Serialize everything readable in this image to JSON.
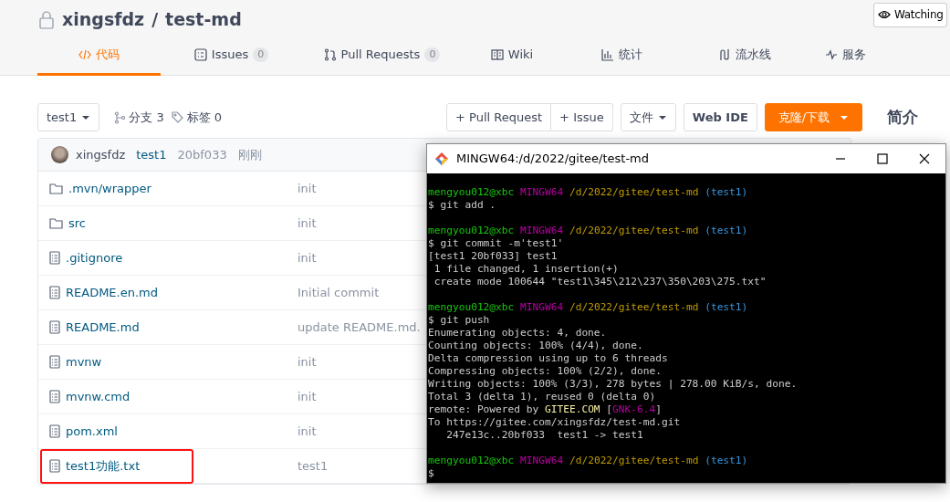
{
  "repo": {
    "owner": "xingsfdz",
    "separator": "/",
    "name": "test-md",
    "watch_label": "Watching"
  },
  "tabs": [
    {
      "kind": "code",
      "label": "代码",
      "selected": true
    },
    {
      "kind": "issues",
      "label": "Issues",
      "count": "0",
      "selected": false
    },
    {
      "kind": "pr",
      "label": "Pull Requests",
      "count": "0",
      "selected": false
    },
    {
      "kind": "wiki",
      "label": "Wiki",
      "selected": false
    },
    {
      "kind": "stats",
      "label": "统计",
      "selected": false
    },
    {
      "kind": "pipeline",
      "label": "流水线",
      "selected": false
    },
    {
      "kind": "service",
      "label": "服务",
      "selected": false
    }
  ],
  "toolbar": {
    "branch": "test1",
    "branches": "分支 3",
    "tags": "标签 0",
    "new_pr": "+ Pull Request",
    "new_issue": "+ Issue",
    "file_menu": "文件",
    "web_ide": "Web IDE",
    "clone": "克隆/下载"
  },
  "sidebar": {
    "title": "简介"
  },
  "commit": {
    "author": "xingsfdz",
    "message": "test1",
    "hash": "20bf033",
    "time": "刚刚"
  },
  "files": [
    {
      "kind": "folder",
      "name": ".mvn/wrapper",
      "message": "init",
      "highlighted": false
    },
    {
      "kind": "folder",
      "name": "src",
      "message": "init",
      "highlighted": false
    },
    {
      "kind": "file",
      "name": ".gitignore",
      "message": "init",
      "highlighted": false
    },
    {
      "kind": "file",
      "name": "README.en.md",
      "message": "Initial commit",
      "highlighted": false
    },
    {
      "kind": "file",
      "name": "README.md",
      "message": "update README.md.",
      "highlighted": false
    },
    {
      "kind": "file",
      "name": "mvnw",
      "message": "init",
      "highlighted": false
    },
    {
      "kind": "file",
      "name": "mvnw.cmd",
      "message": "init",
      "highlighted": false
    },
    {
      "kind": "file",
      "name": "pom.xml",
      "message": "init",
      "highlighted": false
    },
    {
      "kind": "file",
      "name": "test1功能.txt",
      "message": "test1",
      "highlighted": true
    }
  ],
  "terminal": {
    "title": "MINGW64:/d/2022/gitee/test-md",
    "lines": [
      {
        "kind": "text",
        "segments": [
          {
            "kind": "user",
            "text": "mengyou012@xbc"
          },
          {
            "kind": "system",
            "text": "MINGW64"
          },
          {
            "kind": "path",
            "text": "/d/2022/gitee/test-md"
          },
          {
            "kind": "branch",
            "text": "(test1)"
          }
        ]
      },
      {
        "kind": "text",
        "segments": [
          {
            "kind": "plain",
            "text": "$ git add ."
          }
        ]
      },
      {
        "kind": "blank"
      },
      {
        "kind": "text",
        "segments": [
          {
            "kind": "user",
            "text": "mengyou012@xbc"
          },
          {
            "kind": "system",
            "text": "MINGW64"
          },
          {
            "kind": "path",
            "text": "/d/2022/gitee/test-md"
          },
          {
            "kind": "branch",
            "text": "(test1)"
          }
        ]
      },
      {
        "kind": "text",
        "segments": [
          {
            "kind": "plain",
            "text": "$ git commit -m'test1'"
          }
        ]
      },
      {
        "kind": "text",
        "segments": [
          {
            "kind": "plain",
            "text": "[test1 20bf033] test1"
          }
        ]
      },
      {
        "kind": "text",
        "segments": [
          {
            "kind": "plain",
            "text": " 1 file changed, 1 insertion(+)"
          }
        ]
      },
      {
        "kind": "text",
        "segments": [
          {
            "kind": "plain",
            "text": " create mode 100644 \"test1\\345\\212\\237\\350\\203\\275.txt\""
          }
        ]
      },
      {
        "kind": "blank"
      },
      {
        "kind": "text",
        "segments": [
          {
            "kind": "user",
            "text": "mengyou012@xbc"
          },
          {
            "kind": "system",
            "text": "MINGW64"
          },
          {
            "kind": "path",
            "text": "/d/2022/gitee/test-md"
          },
          {
            "kind": "branch",
            "text": "(test1)"
          }
        ]
      },
      {
        "kind": "text",
        "segments": [
          {
            "kind": "plain",
            "text": "$ git push"
          }
        ]
      },
      {
        "kind": "text",
        "segments": [
          {
            "kind": "plain",
            "text": "Enumerating objects: 4, done."
          }
        ]
      },
      {
        "kind": "text",
        "segments": [
          {
            "kind": "plain",
            "text": "Counting objects: 100% (4/4), done."
          }
        ]
      },
      {
        "kind": "text",
        "segments": [
          {
            "kind": "plain",
            "text": "Delta compression using up to 6 threads"
          }
        ]
      },
      {
        "kind": "text",
        "segments": [
          {
            "kind": "plain",
            "text": "Compressing objects: 100% (2/2), done."
          }
        ]
      },
      {
        "kind": "text",
        "segments": [
          {
            "kind": "plain",
            "text": "Writing objects: 100% (3/3), 278 bytes | 278.00 KiB/s, done."
          }
        ]
      },
      {
        "kind": "text",
        "segments": [
          {
            "kind": "plain",
            "text": "Total 3 (delta 1), reused 0 (delta 0)"
          }
        ]
      },
      {
        "kind": "text",
        "segments": [
          {
            "kind": "plain",
            "text": "remote: Powered by "
          },
          {
            "kind": "highlight",
            "text": "GITEE.COM"
          },
          {
            "kind": "plain",
            "text": " ["
          },
          {
            "kind": "system",
            "text": "GNK-6.4"
          },
          {
            "kind": "plain",
            "text": "]"
          }
        ]
      },
      {
        "kind": "text",
        "segments": [
          {
            "kind": "plain",
            "text": "To https://gitee.com/xingsfdz/test-md.git"
          }
        ]
      },
      {
        "kind": "text",
        "segments": [
          {
            "kind": "plain",
            "text": "   247e13c..20bf033  test1 -> test1"
          }
        ]
      },
      {
        "kind": "blank"
      },
      {
        "kind": "text",
        "segments": [
          {
            "kind": "user",
            "text": "mengyou012@xbc"
          },
          {
            "kind": "system",
            "text": "MINGW64"
          },
          {
            "kind": "path",
            "text": "/d/2022/gitee/test-md"
          },
          {
            "kind": "branch",
            "text": "(test1)"
          }
        ]
      },
      {
        "kind": "text",
        "segments": [
          {
            "kind": "plain",
            "text": "$"
          }
        ]
      }
    ]
  }
}
